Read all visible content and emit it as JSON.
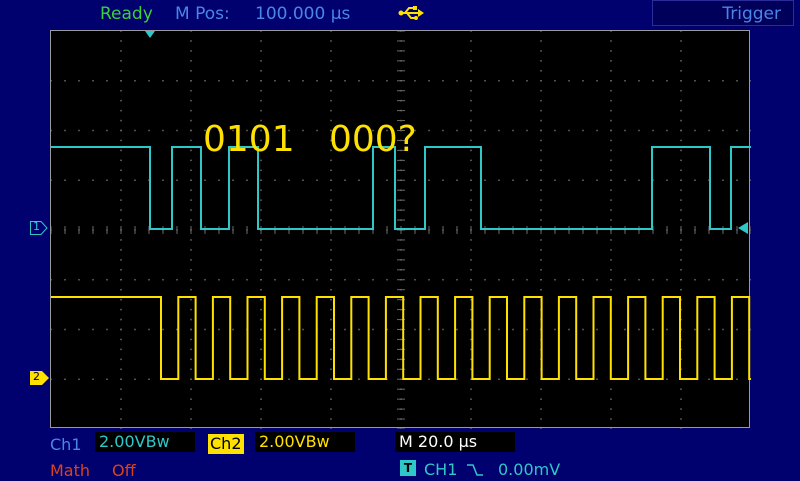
{
  "header": {
    "status": "Ready",
    "mpos_label": "M Pos:",
    "mpos_value": "100.000 µs",
    "usb_icon": "usb-icon",
    "trigger_tab": "Trigger"
  },
  "screen": {
    "annotation": "0101   000?",
    "ch1_marker": "1",
    "ch2_marker": "2",
    "ch1_color": "#2fc8c8",
    "ch2_color": "#ffe100"
  },
  "bottom": {
    "ch1_label": "Ch1",
    "ch1_scale": "2.00VBw",
    "ch2_label": "Ch2",
    "ch2_scale": "2.00VBw",
    "time_scale": "M 20.0 µs",
    "math_label": "Math",
    "math_state": "Off",
    "trigger_badge": "T",
    "trigger_source": "CH1",
    "trigger_slope_icon": "falling-edge-icon",
    "trigger_level": "0.00mV"
  }
}
